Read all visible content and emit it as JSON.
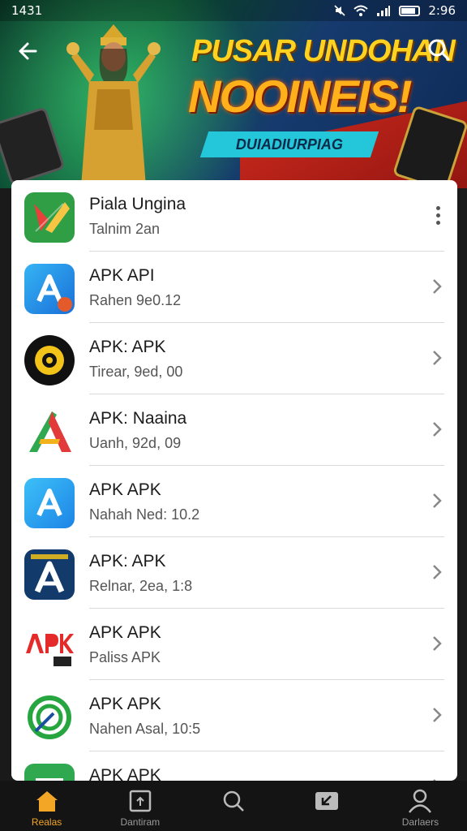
{
  "status_bar": {
    "time_left": "1431",
    "time_right": "2:96"
  },
  "banner": {
    "headline_top": "PUSAR UNDOHAN",
    "headline_main": "NOOINEIS!",
    "sub_pill": "DUIADIURPIAG"
  },
  "list": {
    "items": [
      {
        "title": "Piala Ungina",
        "subtitle": "Talnim 2an",
        "icon": "x-app-icon",
        "action": "more-menu"
      },
      {
        "title": "APK API",
        "subtitle": "Rahen 9e0.12",
        "icon": "a-store-icon",
        "action": "chevron"
      },
      {
        "title": "APK: APK",
        "subtitle": "Tirear, 9ed, 00",
        "icon": "yellow-ring-icon",
        "action": "chevron"
      },
      {
        "title": "APK: Naaina",
        "subtitle": "Uanh, 92d, 09",
        "icon": "colorful-a-icon",
        "action": "chevron"
      },
      {
        "title": "APK APK",
        "subtitle": "Nahah Ned: 10.2",
        "icon": "a-store-blue-icon",
        "action": "chevron"
      },
      {
        "title": "APK: APK",
        "subtitle": "Relnar, 2ea, 1:8",
        "icon": "a-navy-icon",
        "action": "chevron"
      },
      {
        "title": "APK APK",
        "subtitle": "Paliss APK",
        "icon": "apk-red-logo-icon",
        "action": "chevron"
      },
      {
        "title": "APK APK",
        "subtitle": "Nahen Asal, 10:5",
        "icon": "green-circle-icon",
        "action": "chevron"
      },
      {
        "title": "APK APK",
        "subtitle": "",
        "icon": "green-red-icon",
        "action": "chevron"
      }
    ]
  },
  "bottom_nav": [
    {
      "label": "Realas",
      "icon": "home-icon",
      "active": true
    },
    {
      "label": "Dantiram",
      "icon": "box-icon",
      "active": false
    },
    {
      "label": "",
      "icon": "search-icon",
      "active": false
    },
    {
      "label": "",
      "icon": "download-icon",
      "active": false
    },
    {
      "label": "Darlaers",
      "icon": "person-icon",
      "active": false
    }
  ],
  "colors": {
    "accent": "#f3a626",
    "banner_headline": "#ffd21f",
    "pill": "#23c7d9"
  }
}
